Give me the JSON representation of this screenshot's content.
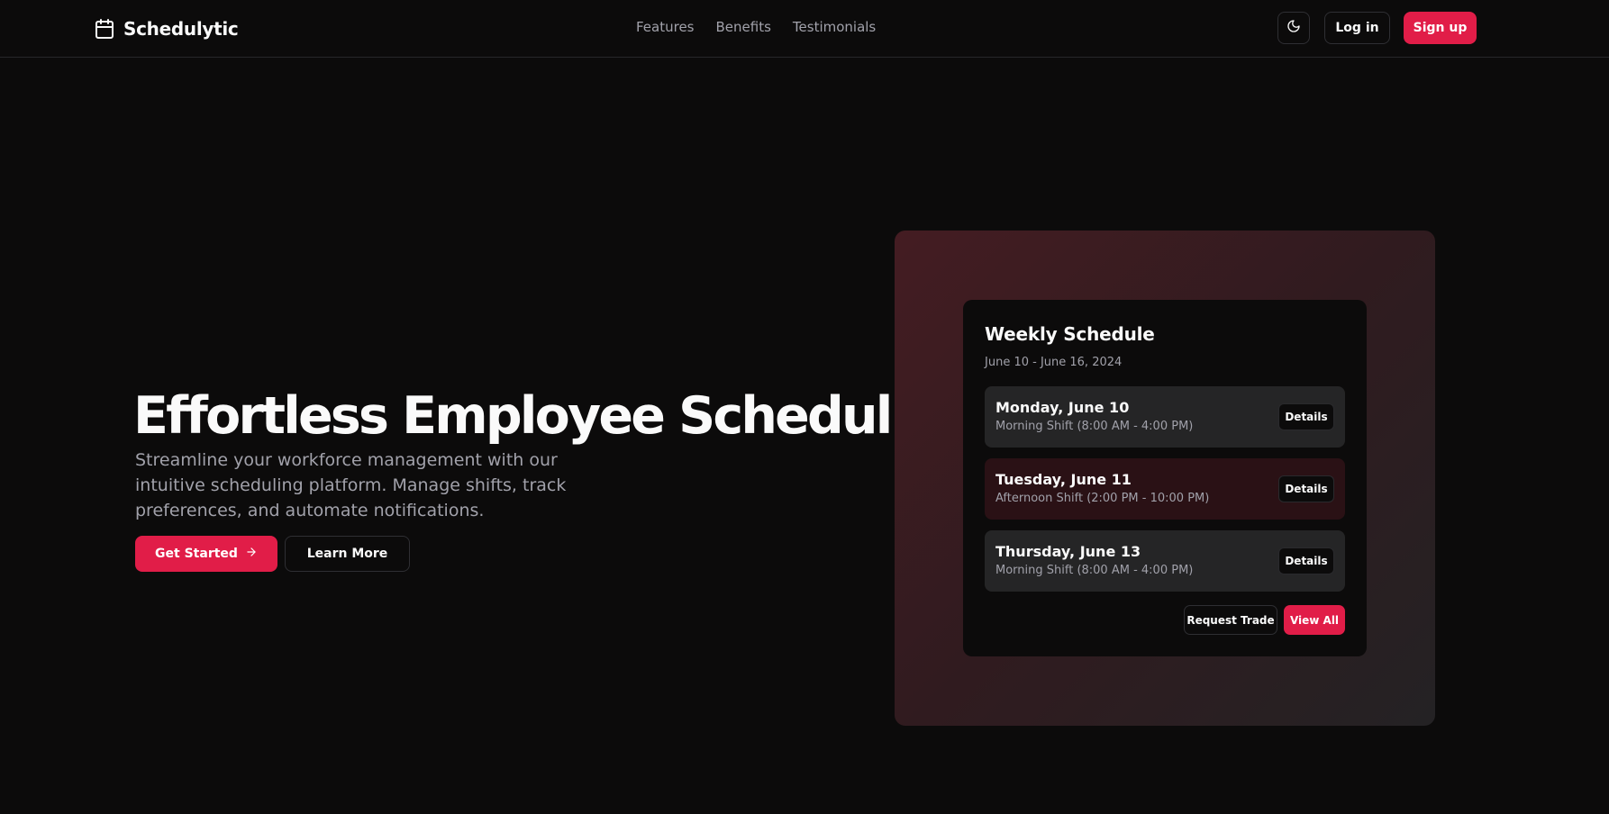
{
  "nav": {
    "brand": "Schedulytic",
    "links": [
      "Features",
      "Benefits",
      "Testimonials"
    ],
    "login_label": "Log in",
    "signup_label": "Sign up"
  },
  "hero": {
    "title": "Effortless Employee Scheduling",
    "subtitle": "Streamline your workforce management with our intuitive scheduling platform. Manage shifts, track preferences, and automate notifications.",
    "primary_cta": "Get Started",
    "secondary_cta": "Learn More"
  },
  "schedule": {
    "title": "Weekly Schedule",
    "range": "June 10 - June 16, 2024",
    "shifts": [
      {
        "day": "Monday, June 10",
        "time": "Morning Shift (8:00 AM - 4:00 PM)",
        "action": "Details"
      },
      {
        "day": "Tuesday, June 11",
        "time": "Afternoon Shift (2:00 PM - 10:00 PM)",
        "action": "Details"
      },
      {
        "day": "Thursday, June 13",
        "time": "Morning Shift (8:00 AM - 4:00 PM)",
        "action": "Details"
      }
    ],
    "trade_label": "Request Trade",
    "view_all_label": "View All"
  },
  "colors": {
    "accent": "#e11d48",
    "background": "#0c0b0b"
  },
  "icons": {
    "brand": "calendar-icon",
    "theme": "moon-icon",
    "cta": "arrow-right-icon"
  }
}
